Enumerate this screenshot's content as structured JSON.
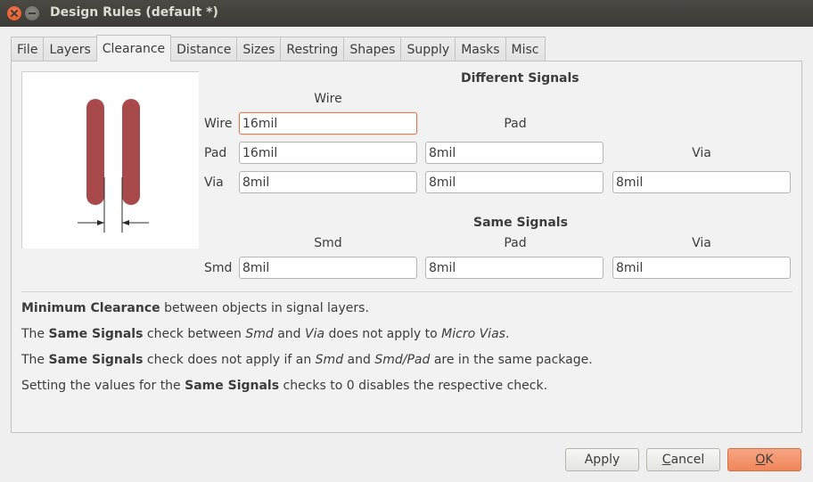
{
  "window": {
    "title": "Design Rules (default *)"
  },
  "tabs": [
    {
      "label": "File"
    },
    {
      "label": "Layers"
    },
    {
      "label": "Clearance"
    },
    {
      "label": "Distance"
    },
    {
      "label": "Sizes"
    },
    {
      "label": "Restring"
    },
    {
      "label": "Shapes"
    },
    {
      "label": "Supply"
    },
    {
      "label": "Masks"
    },
    {
      "label": "Misc"
    }
  ],
  "active_tab": "Clearance",
  "different_signals": {
    "heading": "Different Signals",
    "col_wire": "Wire",
    "col_pad": "Pad",
    "col_via": "Via",
    "row_wire": "Wire",
    "row_pad": "Pad",
    "row_via": "Via",
    "wire_wire": "16mil",
    "pad_wire": "16mil",
    "pad_pad": "8mil",
    "via_wire": "8mil",
    "via_pad": "8mil",
    "via_via": "8mil"
  },
  "same_signals": {
    "heading": "Same Signals",
    "col_smd": "Smd",
    "col_pad": "Pad",
    "col_via": "Via",
    "row_smd": "Smd",
    "smd_smd": "8mil",
    "smd_pad": "8mil",
    "smd_via": "8mil"
  },
  "notes": {
    "n1_b": "Minimum Clearance",
    "n1_t": " between objects in signal layers.",
    "n2_a": "The ",
    "n2_b": "Same Signals",
    "n2_c": " check between ",
    "n2_i1": "Smd",
    "n2_d": " and ",
    "n2_i2": "Via",
    "n2_e": " does not apply to ",
    "n2_i3": "Micro Vias",
    "n2_f": ".",
    "n3_a": "The ",
    "n3_b": "Same Signals",
    "n3_c": " check does not apply if an ",
    "n3_i1": "Smd",
    "n3_d": " and ",
    "n3_i2": "Smd/Pad",
    "n3_e": " are in the same package.",
    "n4_a": "Setting the values for the ",
    "n4_b": "Same Signals",
    "n4_c": " checks to 0 disables the respective check."
  },
  "buttons": {
    "apply": "Apply",
    "cancel_u": "C",
    "cancel_rest": "ancel",
    "ok_u": "O",
    "ok_rest": "K"
  },
  "colors": {
    "trace": "#a84a4c",
    "accent": "#f08659",
    "focus_border": "#e07a4f"
  }
}
